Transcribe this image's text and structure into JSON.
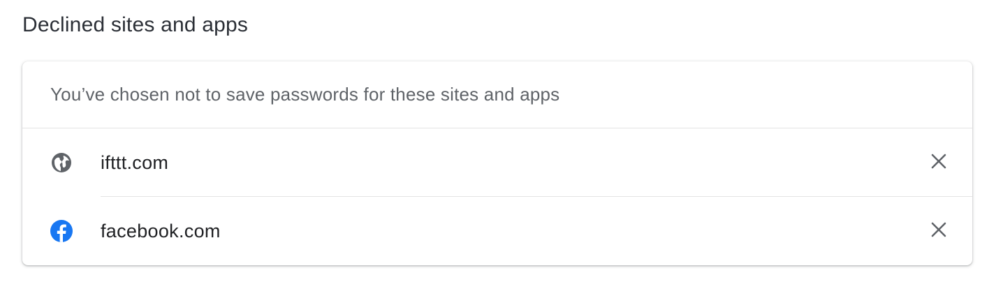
{
  "section": {
    "title": "Declined sites and apps"
  },
  "card": {
    "description": "You’ve chosen not to save passwords for these sites and apps"
  },
  "sites": [
    {
      "name": "ifttt.com",
      "icon": "globe-icon",
      "remove_icon": "close-icon"
    },
    {
      "name": "facebook.com",
      "icon": "facebook-icon",
      "remove_icon": "close-icon"
    }
  ],
  "colors": {
    "facebook_blue": "#1877f2",
    "globe_gray": "#5f6368",
    "close_gray": "#5f6368"
  }
}
